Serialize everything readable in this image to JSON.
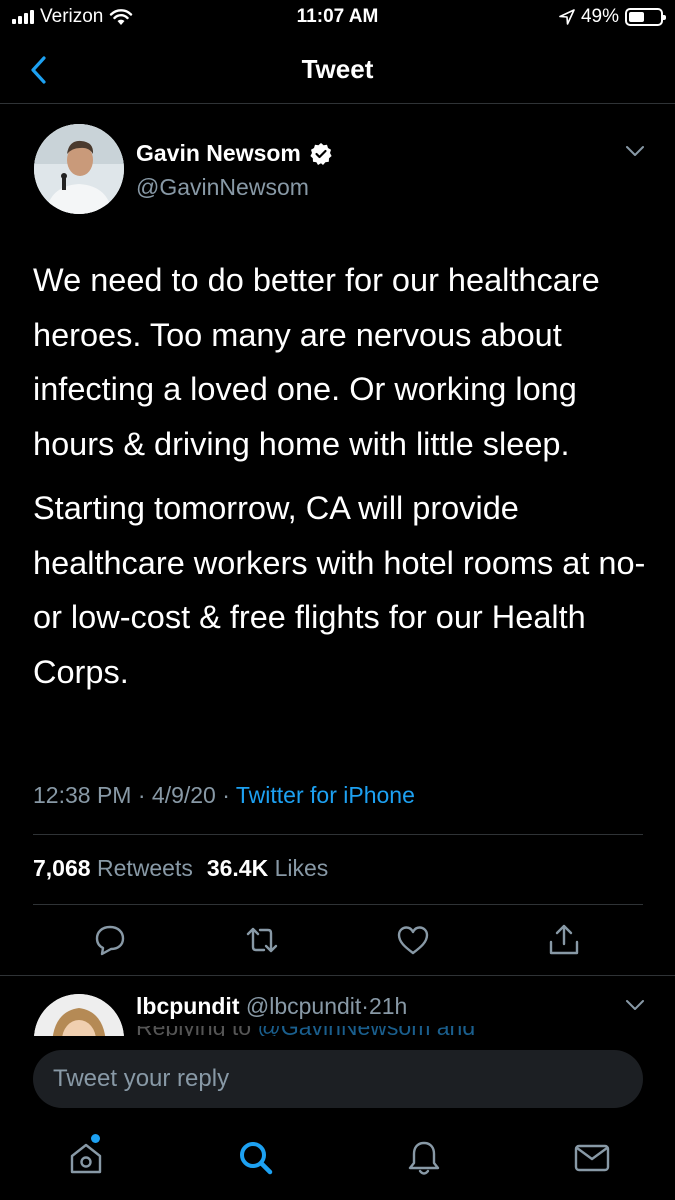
{
  "status_bar": {
    "carrier": "Verizon",
    "time": "11:07 AM",
    "battery": "49%",
    "battery_level": 0.49
  },
  "nav": {
    "title": "Tweet"
  },
  "tweet": {
    "author_name": "Gavin Newsom",
    "author_handle": "@GavinNewsom",
    "paragraphs": [
      "We need to do better for our healthcare heroes. Too many are nervous about infecting a loved one. Or working long hours & driving home with little sleep.",
      "Starting tomorrow, CA will provide healthcare workers with hotel rooms at no-or low-cost & free flights for our Health Corps."
    ],
    "time": "12:38 PM",
    "sep1": "·",
    "date": "4/9/20",
    "sep2": "·",
    "source": "Twitter for iPhone",
    "retweets_count": "7,068",
    "retweets_label": "Retweets",
    "likes_count": "36.4K",
    "likes_label": "Likes"
  },
  "reply_preview": {
    "name": "lbcpundit",
    "handle": "@lbcpundit",
    "sep": "·",
    "age": "21h",
    "snippet_prefix": "Replying to",
    "snippet_mention": "@GavinNewsom and"
  },
  "reply_box": {
    "placeholder": "Tweet your reply"
  },
  "colors": {
    "background": "#000000",
    "accent": "#1da1f2",
    "secondary_text": "#8899a6",
    "divider": "#2f3336"
  },
  "icons": {
    "back": "chevron-left-icon",
    "verified": "verified-badge-icon",
    "reply": "comment-icon",
    "retweet": "retweet-icon",
    "like": "heart-icon",
    "share": "share-icon",
    "home": "home-icon",
    "search": "search-icon",
    "notifications": "bell-icon",
    "messages": "mail-icon"
  }
}
